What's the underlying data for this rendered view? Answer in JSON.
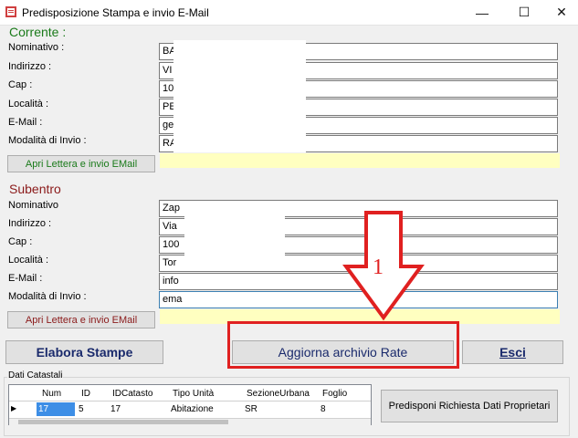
{
  "window": {
    "title": "Predisposizione Stampa e invio E-Mail",
    "minimize_glyph": "—",
    "maximize_glyph": "☐",
    "close_glyph": "✕"
  },
  "corrente": {
    "title": "Corrente :",
    "labels": [
      "Nominativo :",
      "Indirizzo :",
      "Cap :",
      "Località :",
      "E-Mail  :",
      "Modalità di Invio :"
    ],
    "values": [
      "BA",
      "VI",
      "10",
      "PE",
      "ge",
      "RA"
    ],
    "button": "Apri Lettera e invio EMail"
  },
  "subentro": {
    "title": "Subentro",
    "labels": [
      "Nominativo",
      "Indirizzo :",
      "Cap :",
      "Località :",
      "E-Mail  :",
      "Modalità di Invio :"
    ],
    "values": [
      "Zap",
      "Via",
      "100",
      "Tor",
      "info",
      "ema"
    ],
    "button": "Apri Lettera e invio EMail"
  },
  "annotation": {
    "number": "1",
    "color": "#e02020"
  },
  "actions": {
    "elabora": "Elabora Stampe",
    "aggiorna": "Aggiorna  archivio Rate",
    "esci": "Esci"
  },
  "dati_catastali": {
    "title": "Dati Catastali",
    "columns": [
      "Num",
      "ID",
      "IDCatasto",
      "Tipo Unità",
      "SezioneUrbana",
      "Foglio"
    ],
    "row": [
      "17",
      "5",
      "17",
      "Abitazione",
      "SR",
      "8"
    ],
    "row_marker": "▶",
    "button": "Predisponi Richiesta Dati Proprietari"
  }
}
